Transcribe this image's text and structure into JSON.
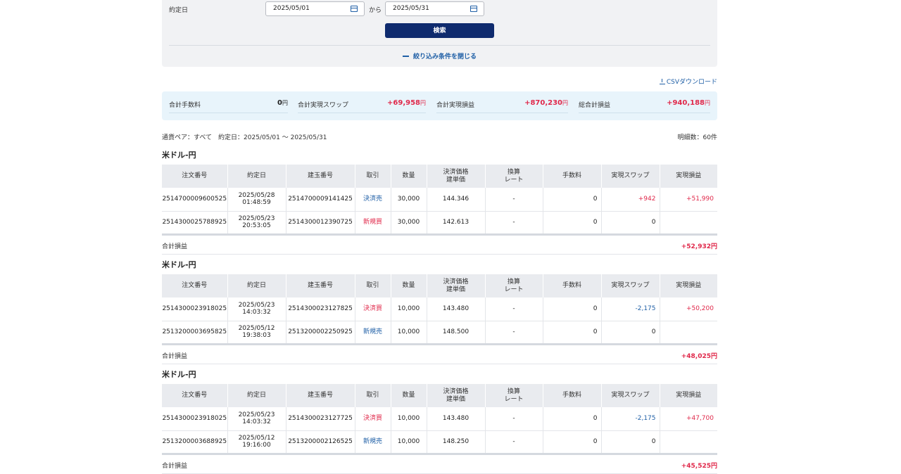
{
  "filter": {
    "date_label": "約定日",
    "date_from": "2025/05/01",
    "date_to": "2025/05/31",
    "between": "から",
    "search_label": "検索",
    "close_label": "絞り込み条件を閉じる"
  },
  "csv_label": "CSVダウンロード",
  "summary": {
    "fee_label": "合計手数料",
    "fee_value": "0",
    "fee_unit": "円",
    "swap_label": "合計実現スワップ",
    "swap_value": "+69,958",
    "swap_unit": "円",
    "pnl_label": "合計実現損益",
    "pnl_value": "+870,230",
    "pnl_unit": "円",
    "total_label": "総合計損益",
    "total_value": "+940,188",
    "total_unit": "円"
  },
  "conditions": "通貨ペア：すべて　約定日：2025/05/01 ～ 2025/05/31",
  "count": "明細数：60件",
  "table_headers": [
    "注文番号",
    "約定日",
    "建玉番号",
    "取引",
    "数量",
    "決済価格\n建単価",
    "換算\nレート",
    "手数料",
    "実現スワップ",
    "実現損益"
  ],
  "sections": [
    {
      "title": "米ドル-円",
      "rows": [
        {
          "order": "2514700009600525",
          "date": "2025/05/28",
          "time": "01:48:59",
          "position": "2514700009141425",
          "trade": "決済売",
          "trade_color": "blue",
          "qty": "30,000",
          "price": "144.346",
          "rate": "-",
          "fee": "0",
          "swap": "+942",
          "swap_color": "red",
          "pnl": "+51,990",
          "pnl_color": "red"
        },
        {
          "order": "2514300025788925",
          "date": "2025/05/23",
          "time": "20:53:05",
          "position": "2514300012390725",
          "trade": "新規買",
          "trade_color": "red",
          "qty": "30,000",
          "price": "142.613",
          "rate": "-",
          "fee": "0",
          "swap": "0",
          "swap_color": "",
          "pnl": "",
          "pnl_color": ""
        }
      ],
      "total_label": "合計損益",
      "total_value": "+52,932円"
    },
    {
      "title": "米ドル-円",
      "rows": [
        {
          "order": "2514300023918025",
          "date": "2025/05/23",
          "time": "14:03:32",
          "position": "2514300023127825",
          "trade": "決済買",
          "trade_color": "red",
          "qty": "10,000",
          "price": "143.480",
          "rate": "-",
          "fee": "0",
          "swap": "-2,175",
          "swap_color": "blue",
          "pnl": "+50,200",
          "pnl_color": "red"
        },
        {
          "order": "2513200003695825",
          "date": "2025/05/12",
          "time": "19:38:03",
          "position": "2513200002250925",
          "trade": "新規売",
          "trade_color": "blue",
          "qty": "10,000",
          "price": "148.500",
          "rate": "-",
          "fee": "0",
          "swap": "0",
          "swap_color": "",
          "pnl": "",
          "pnl_color": ""
        }
      ],
      "total_label": "合計損益",
      "total_value": "+48,025円"
    },
    {
      "title": "米ドル-円",
      "rows": [
        {
          "order": "2514300023918025",
          "date": "2025/05/23",
          "time": "14:03:32",
          "position": "2514300023127725",
          "trade": "決済買",
          "trade_color": "red",
          "qty": "10,000",
          "price": "143.480",
          "rate": "-",
          "fee": "0",
          "swap": "-2,175",
          "swap_color": "blue",
          "pnl": "+47,700",
          "pnl_color": "red"
        },
        {
          "order": "2513200003688925",
          "date": "2025/05/12",
          "time": "19:16:00",
          "position": "2513200002126525",
          "trade": "新規売",
          "trade_color": "blue",
          "qty": "10,000",
          "price": "148.250",
          "rate": "-",
          "fee": "0",
          "swap": "0",
          "swap_color": "",
          "pnl": "",
          "pnl_color": ""
        }
      ],
      "total_label": "合計損益",
      "total_value": "+45,525円"
    }
  ]
}
